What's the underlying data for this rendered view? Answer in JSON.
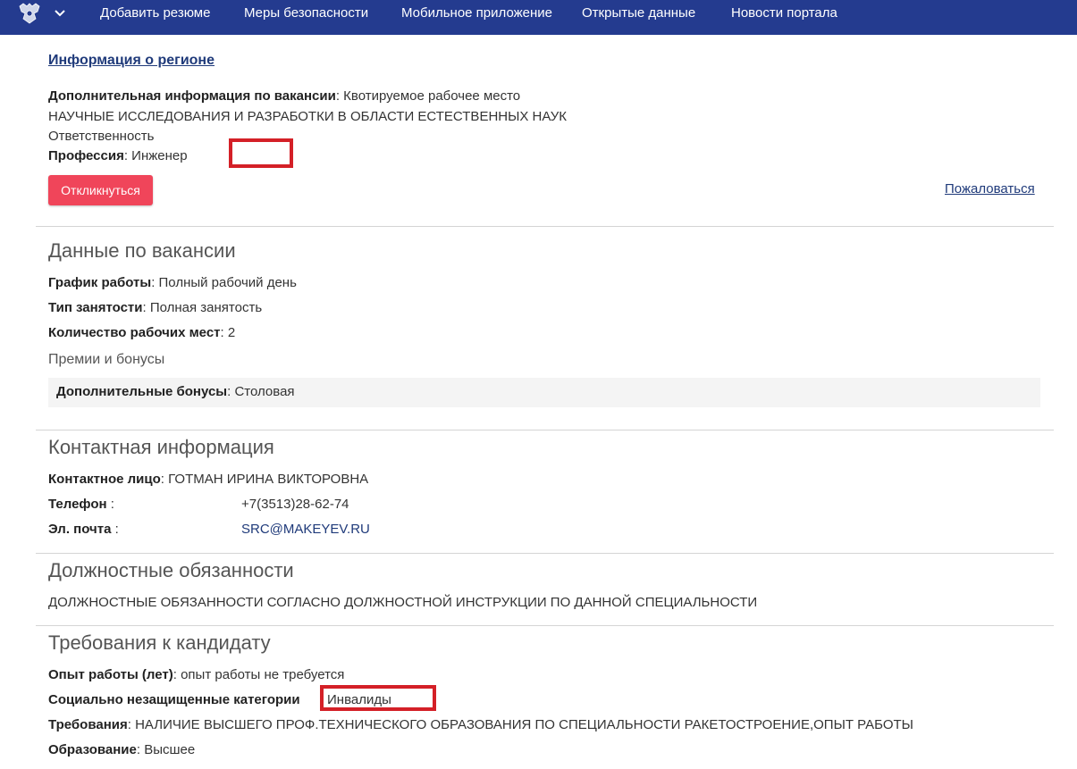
{
  "nav": {
    "items": [
      "Добавить резюме",
      "Меры безопасности",
      "Мобильное приложение",
      "Открытые данные",
      "Новости портала"
    ]
  },
  "region_link": "Информация о регионе",
  "vacancy_info": {
    "additional_label": "Дополнительная информация по вакансии",
    "additional_value": ": Квотируемое рабочее место",
    "field": "НАУЧНЫЕ ИССЛЕДОВАНИЯ И РАЗРАБОТКИ В ОБЛАСТИ ЕСТЕСТВЕННЫХ НАУК",
    "quality": "Ответственность",
    "profession_label": "Профессия",
    "profession_value": ": Инженер"
  },
  "actions": {
    "respond_label": "Откликнуться",
    "complain_label": "Пожаловаться"
  },
  "vacancy_data": {
    "title": "Данные по вакансии",
    "schedule_label": "График работы",
    "schedule_value": ": Полный рабочий день",
    "employment_label": "Тип занятости",
    "employment_value": ": Полная занятость",
    "places_label": "Количество рабочих мест",
    "places_value": ": 2",
    "bonuses_heading": "Премии и бонусы",
    "bonus_label": "Дополнительные бонусы",
    "bonus_value": ": Столовая"
  },
  "contact": {
    "title": "Контактная информация",
    "person_label": "Контактное лицо",
    "person_value": ": ГОТМАН ИРИНА ВИКТОРОВНА",
    "phone_label": "Телефон",
    "phone_sep": " :",
    "phone_value": "+7(3513)28-62-74",
    "email_label": "Эл. почта",
    "email_sep": " :",
    "email_value": "SRC@MAKEYEV.RU"
  },
  "duties": {
    "title": "Должностные обязанности",
    "text": "ДОЛЖНОСТНЫЕ ОБЯЗАННОСТИ СОГЛАСНО ДОЛЖНОСТНОЙ ИНСТРУКЦИИ ПО ДАННОЙ СПЕЦИАЛЬНОСТИ"
  },
  "requirements": {
    "title": "Требования к кандидату",
    "experience_label": "Опыт работы (лет)",
    "experience_value": ": опыт работы не требуется",
    "social_label": "Социально незащищенные категории",
    "social_value": "Инвалиды",
    "req_label": "Требования",
    "req_value": ": НАЛИЧИЕ ВЫСШЕГО ПРОФ.ТЕХНИЧЕСКОГО ОБРАЗОВАНИЯ ПО СПЕЦИАЛЬНОСТИ РАКЕТОСТРОЕНИЕ,ОПЫТ РАБОТЫ",
    "edu_label": "Образование",
    "edu_value": ": Высшее"
  },
  "colors": {
    "navbar": "#243b8f",
    "accent_button": "#f0455a",
    "highlight_box": "#d42027",
    "link": "#1f3a7a"
  }
}
